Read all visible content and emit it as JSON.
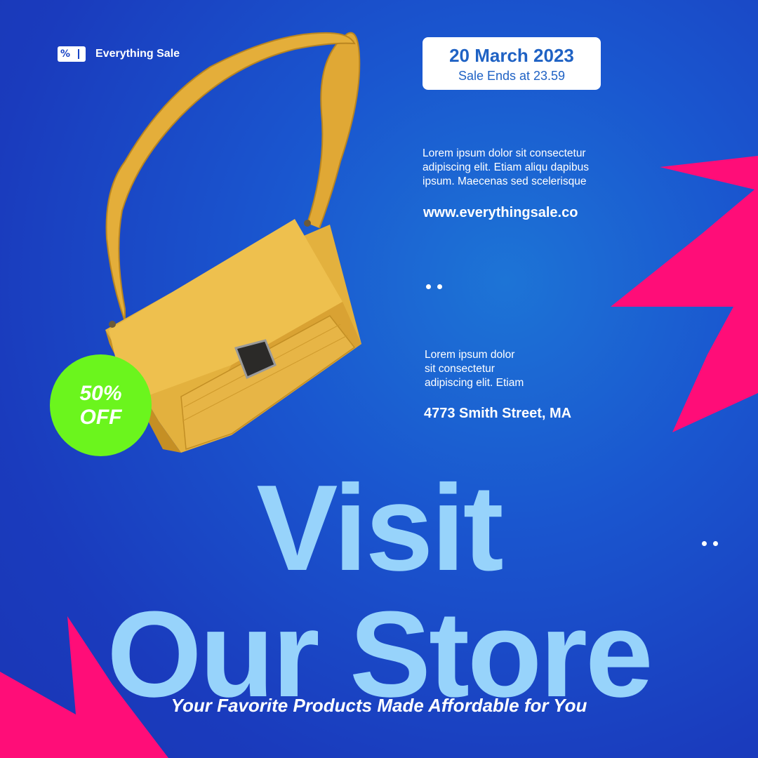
{
  "brand": {
    "name": "Everything Sale",
    "logo_text": "%"
  },
  "date_card": {
    "title": "20 March 2023",
    "subtitle": "Sale Ends at 23.59"
  },
  "info": {
    "lines": [
      "Lorem ipsum dolor sit consectetur",
      "adipiscing elit. Etiam aliqu dapibus",
      "ipsum. Maecenas sed scelerisque"
    ],
    "website": "www.everythingsale.co"
  },
  "location": {
    "lines": [
      "Lorem ipsum dolor",
      "sit consectetur",
      "adipiscing elit. Etiam"
    ],
    "address": "4773 Smith Street, MA"
  },
  "discount": {
    "line1": "50%",
    "line2": "OFF"
  },
  "headline": {
    "line1": "Visit",
    "line2": "Our Store"
  },
  "tagline": "Your Favorite Products Made Affordable for You",
  "colors": {
    "background": "#1a45c6",
    "accent_pink": "#ff0d78",
    "headline": "#97d3fb",
    "badge_green": "#6bf51d",
    "bag_yellow": "#e8b63a",
    "date_text": "#1f62c4"
  },
  "icons": {
    "brand_logo": "percent-ticket-icon"
  }
}
